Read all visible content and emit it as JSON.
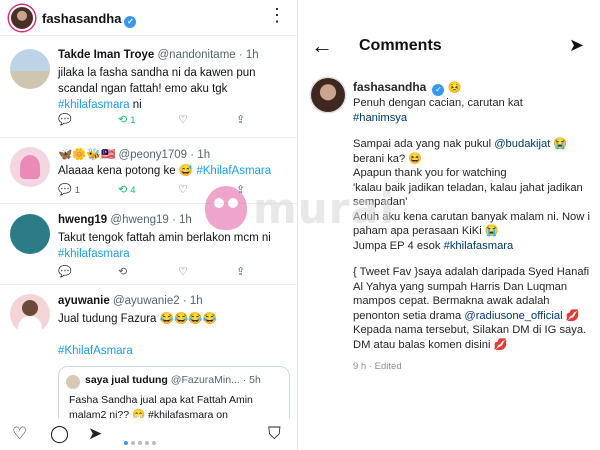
{
  "instagram": {
    "username": "fashasandha",
    "verified_symbol": "✓",
    "more_icon": "more-vertical-icon"
  },
  "tweets": [
    {
      "name": "Takde Iman Troye",
      "meta": "@nandonitame · 1h",
      "body_prefix": "jilaka la fasha sandha ni da kawen pun scandal ngan fattah! emo aku tgk",
      "hashtag": "#khilafasmara",
      "body_suffix": " ni",
      "retweets": "1"
    },
    {
      "name": "🦋🌼🐝🇲🇾",
      "meta": "@peony1709 · 1h",
      "body_prefix": "Alaaaa kena potong ke 😅 ",
      "hashtag": "#KhilafAsmara",
      "body_suffix": "",
      "replies": "1",
      "retweets": "4"
    },
    {
      "name": "hweng19",
      "meta": "@hweng19 · 1h",
      "body_prefix": "Takut tengok fattah amin berlakon mcm ni",
      "hashtag": "#khilafasmara",
      "body_suffix": ""
    },
    {
      "name": "ayuwanie",
      "meta": "@ayuwanie2 · 1h",
      "body_prefix": "Jual tudung Fazura 😂😂😂😂",
      "hashtag": "#KhilafAsmara",
      "body_suffix": ""
    }
  ],
  "quote": {
    "name": "saya jual tudung",
    "meta": "@FazuraMin... · 5h",
    "body": "Fasha Sandha jual apa kat Fattah Amin malam2 ni?? 😁 #khilafasmara on"
  },
  "watermark": {
    "text": "murai"
  },
  "comments": {
    "title": "Comments",
    "username": "fashasandha",
    "emoji_after_name": "😣",
    "line1": "Penuh dengan cacian, carutan kat",
    "mention1": "#hanimsya",
    "line2_prefix": "Sampai ada yang nak pukul ",
    "mention2": "@budakijat",
    "line2_suffix": " 😭 berani ka? 😆",
    "line3": "Apapun thank you for watching",
    "line4": "'kalau baik jadikan teladan, kalau jahat jadikan sempadan'",
    "line5": "Aduh aku kena carutan banyak malam ni. Now i paham apa perasaan KiKi 😭",
    "line6_prefix": "Jumpa EP 4 esok ",
    "hashtag_end": "#khilafasmara",
    "line7": "{ Tweet Fav }saya adalah daripada Syed Hanafi Al Yahya yang sumpah Harris Dan Luqman mampos cepat. Bermakna awak adalah penonton setia drama",
    "mention3": "@radiusone_official",
    "line7_suffix": " 💋",
    "line8": "Kepada nama tersebut, Silakan DM di IG saya. DM atau balas komen disini 💋",
    "time": "9 h",
    "edited": "Edited"
  }
}
